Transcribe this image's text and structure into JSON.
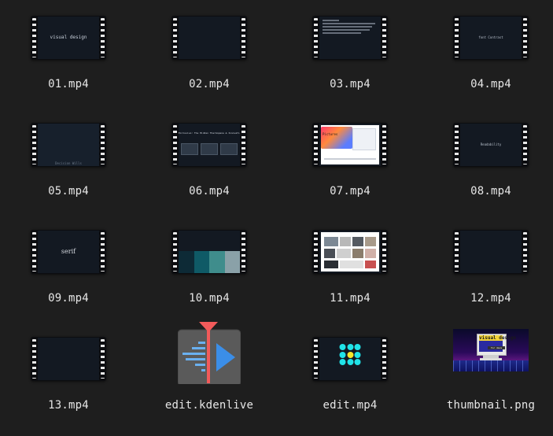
{
  "files": [
    {
      "name": "01.mp4",
      "kind": "video",
      "preview_text": "visual design"
    },
    {
      "name": "02.mp4",
      "kind": "video"
    },
    {
      "name": "03.mp4",
      "kind": "video"
    },
    {
      "name": "04.mp4",
      "kind": "video",
      "preview_text": "font Contrast"
    },
    {
      "name": "05.mp4",
      "kind": "video",
      "preview_text": "Decision Wills"
    },
    {
      "name": "06.mp4",
      "kind": "video",
      "preview_text": "Exclusive: The Hidden Thermopane & Innovation"
    },
    {
      "name": "07.mp4",
      "kind": "video",
      "preview_text": "Pictures"
    },
    {
      "name": "08.mp4",
      "kind": "video",
      "preview_text": "Readability"
    },
    {
      "name": "09.mp4",
      "kind": "video",
      "preview_text": "serif"
    },
    {
      "name": "10.mp4",
      "kind": "video"
    },
    {
      "name": "11.mp4",
      "kind": "video"
    },
    {
      "name": "12.mp4",
      "kind": "video"
    },
    {
      "name": "13.mp4",
      "kind": "video"
    },
    {
      "name": "edit.kdenlive",
      "kind": "kdenlive-project"
    },
    {
      "name": "edit.mp4",
      "kind": "video"
    },
    {
      "name": "thumbnail.png",
      "kind": "image",
      "preview_text": "visual design",
      "preview_subtext": "for devs"
    }
  ],
  "colors": {
    "background": "#1e1e1e",
    "label": "#e6e6e6",
    "film_frame": "#0c0d10",
    "kdenlive_accent": "#3b8ee8",
    "kdenlive_marker": "#f25a5a"
  }
}
